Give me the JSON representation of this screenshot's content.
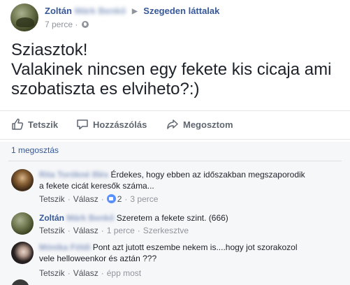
{
  "post": {
    "author_visible": "Zoltán",
    "author_hidden": "Márk Benkő",
    "group": "Szegeden láttalak",
    "time": "7 perce",
    "text_lines": [
      "Sziasztok!",
      "Valakinek nincsen egy fekete kis cicaja ami",
      "szobatiszta es elviheto?:)"
    ]
  },
  "actions": {
    "like": "Tetszik",
    "comment": "Hozzászólás",
    "share": "Megosztom"
  },
  "shares": "1 megosztás",
  "comments": [
    {
      "author": "Rita Torókné Illés",
      "text_line1": "Érdekes, hogy ebben az időszakban megszaporodik",
      "text_line2": "a fekete cicát keresők száma...",
      "like": "Tetszik",
      "reply": "Válasz",
      "reactions": "2",
      "time": "3 perce"
    },
    {
      "author_visible": "Zoltán",
      "author_hidden": "Márk Benkő",
      "text": "Szeretem a fekete szint. (666)",
      "like": "Tetszik",
      "reply": "Válasz",
      "time": "1 perce",
      "edited": "Szerkesztve"
    },
    {
      "author": "Mónika Földi",
      "text_line1": "Pont azt jutott eszembe nekem is....hogy jot szorakozol",
      "text_line2": "vele helloweenkor és aztán ???",
      "like": "Tetszik",
      "reply": "Válasz",
      "time": "épp most"
    }
  ],
  "colors": {
    "link_blue": "#365899",
    "meta_gray": "#90949c",
    "action_gray": "#606770",
    "reaction_blue": "#5890ff"
  }
}
